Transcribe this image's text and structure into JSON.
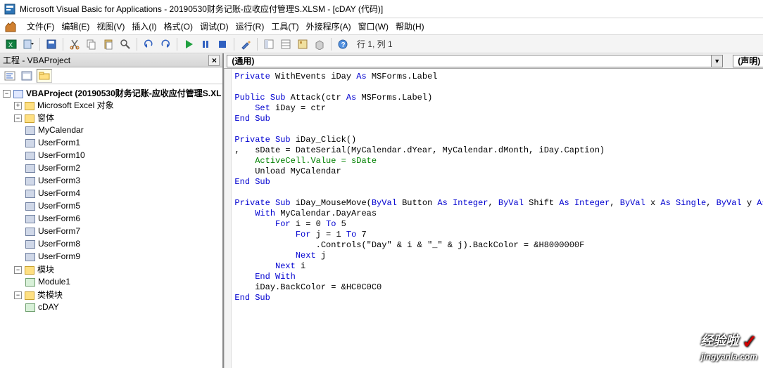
{
  "title": "Microsoft Visual Basic for Applications - 20190530财务记账-应收应付管理S.XLSM - [cDAY (代码)]",
  "menu": {
    "file": "文件(F)",
    "edit": "编辑(E)",
    "view": "视图(V)",
    "insert": "插入(I)",
    "format": "格式(O)",
    "debug": "调试(D)",
    "run": "运行(R)",
    "tools": "工具(T)",
    "addins": "外接程序(A)",
    "window": "窗口(W)",
    "help": "帮助(H)"
  },
  "toolbar": {
    "cursor": "行 1, 列 1"
  },
  "project_pane": {
    "title": "工程 - VBAProject",
    "root": "VBAProject (20190530财务记账-应收应付管理S.XL",
    "excel_objects": "Microsoft Excel 对象",
    "forms": "窗体",
    "form_items": [
      "MyCalendar",
      "UserForm1",
      "UserForm10",
      "UserForm2",
      "UserForm3",
      "UserForm4",
      "UserForm5",
      "UserForm6",
      "UserForm7",
      "UserForm8",
      "UserForm9"
    ],
    "modules": "模块",
    "module_items": [
      "Module1"
    ],
    "class_modules": "类模块",
    "class_items": [
      "cDAY"
    ]
  },
  "code_pane": {
    "object_combo": "(通用)",
    "proc_combo": "(声明)"
  },
  "code": {
    "l1a": "Private",
    "l1b": " WithEvents iDay ",
    "l1c": "As",
    "l1d": " MSForms.Label",
    "l3a": "Public Sub",
    "l3b": " Attack(ctr ",
    "l3c": "As",
    "l3d": " MSForms.Label)",
    "l4a": "    Set",
    "l4b": " iDay = ctr",
    "l5a": "End Sub",
    "l7a": "Private Sub",
    "l7b": " iDay_Click()",
    "l8a": ",   sDate = DateSerial(MyCalendar.dYear, MyCalendar.dMonth, iDay.Caption)",
    "l9a": "    ActiveCell.Value = sDate",
    "l10a": "    Unload MyCalendar",
    "l11a": "End Sub",
    "l13a": "Private Sub",
    "l13b": " iDay_MouseMove(",
    "l13c": "ByVal",
    "l13d": " Button ",
    "l13e": "As Integer",
    "l13f": ", ",
    "l13g": "ByVal",
    "l13h": " Shift ",
    "l13i": "As Integer",
    "l13j": ", ",
    "l13k": "ByVal",
    "l13l": " x ",
    "l13m": "As Single",
    "l13n": ", ",
    "l13o": "ByVal",
    "l13p": " y ",
    "l13q": "As Single",
    "l13r": ")",
    "l14a": "    With",
    "l14b": " MyCalendar.DayAreas",
    "l15a": "        For",
    "l15b": " i = 0 ",
    "l15c": "To",
    "l15d": " 5",
    "l16a": "            For",
    "l16b": " j = 1 ",
    "l16c": "To",
    "l16d": " 7",
    "l17a": "                .Controls(\"Day\" & i & \"_\" & j).BackColor = &H8000000F",
    "l18a": "            Next",
    "l18b": " j",
    "l19a": "        Next",
    "l19b": " i",
    "l20a": "    End With",
    "l21a": "    iDay.BackColor = &HC0C0C0",
    "l22a": "End Sub"
  },
  "watermark": {
    "brand": "经验啦",
    "domain": "jingyanla.com"
  }
}
